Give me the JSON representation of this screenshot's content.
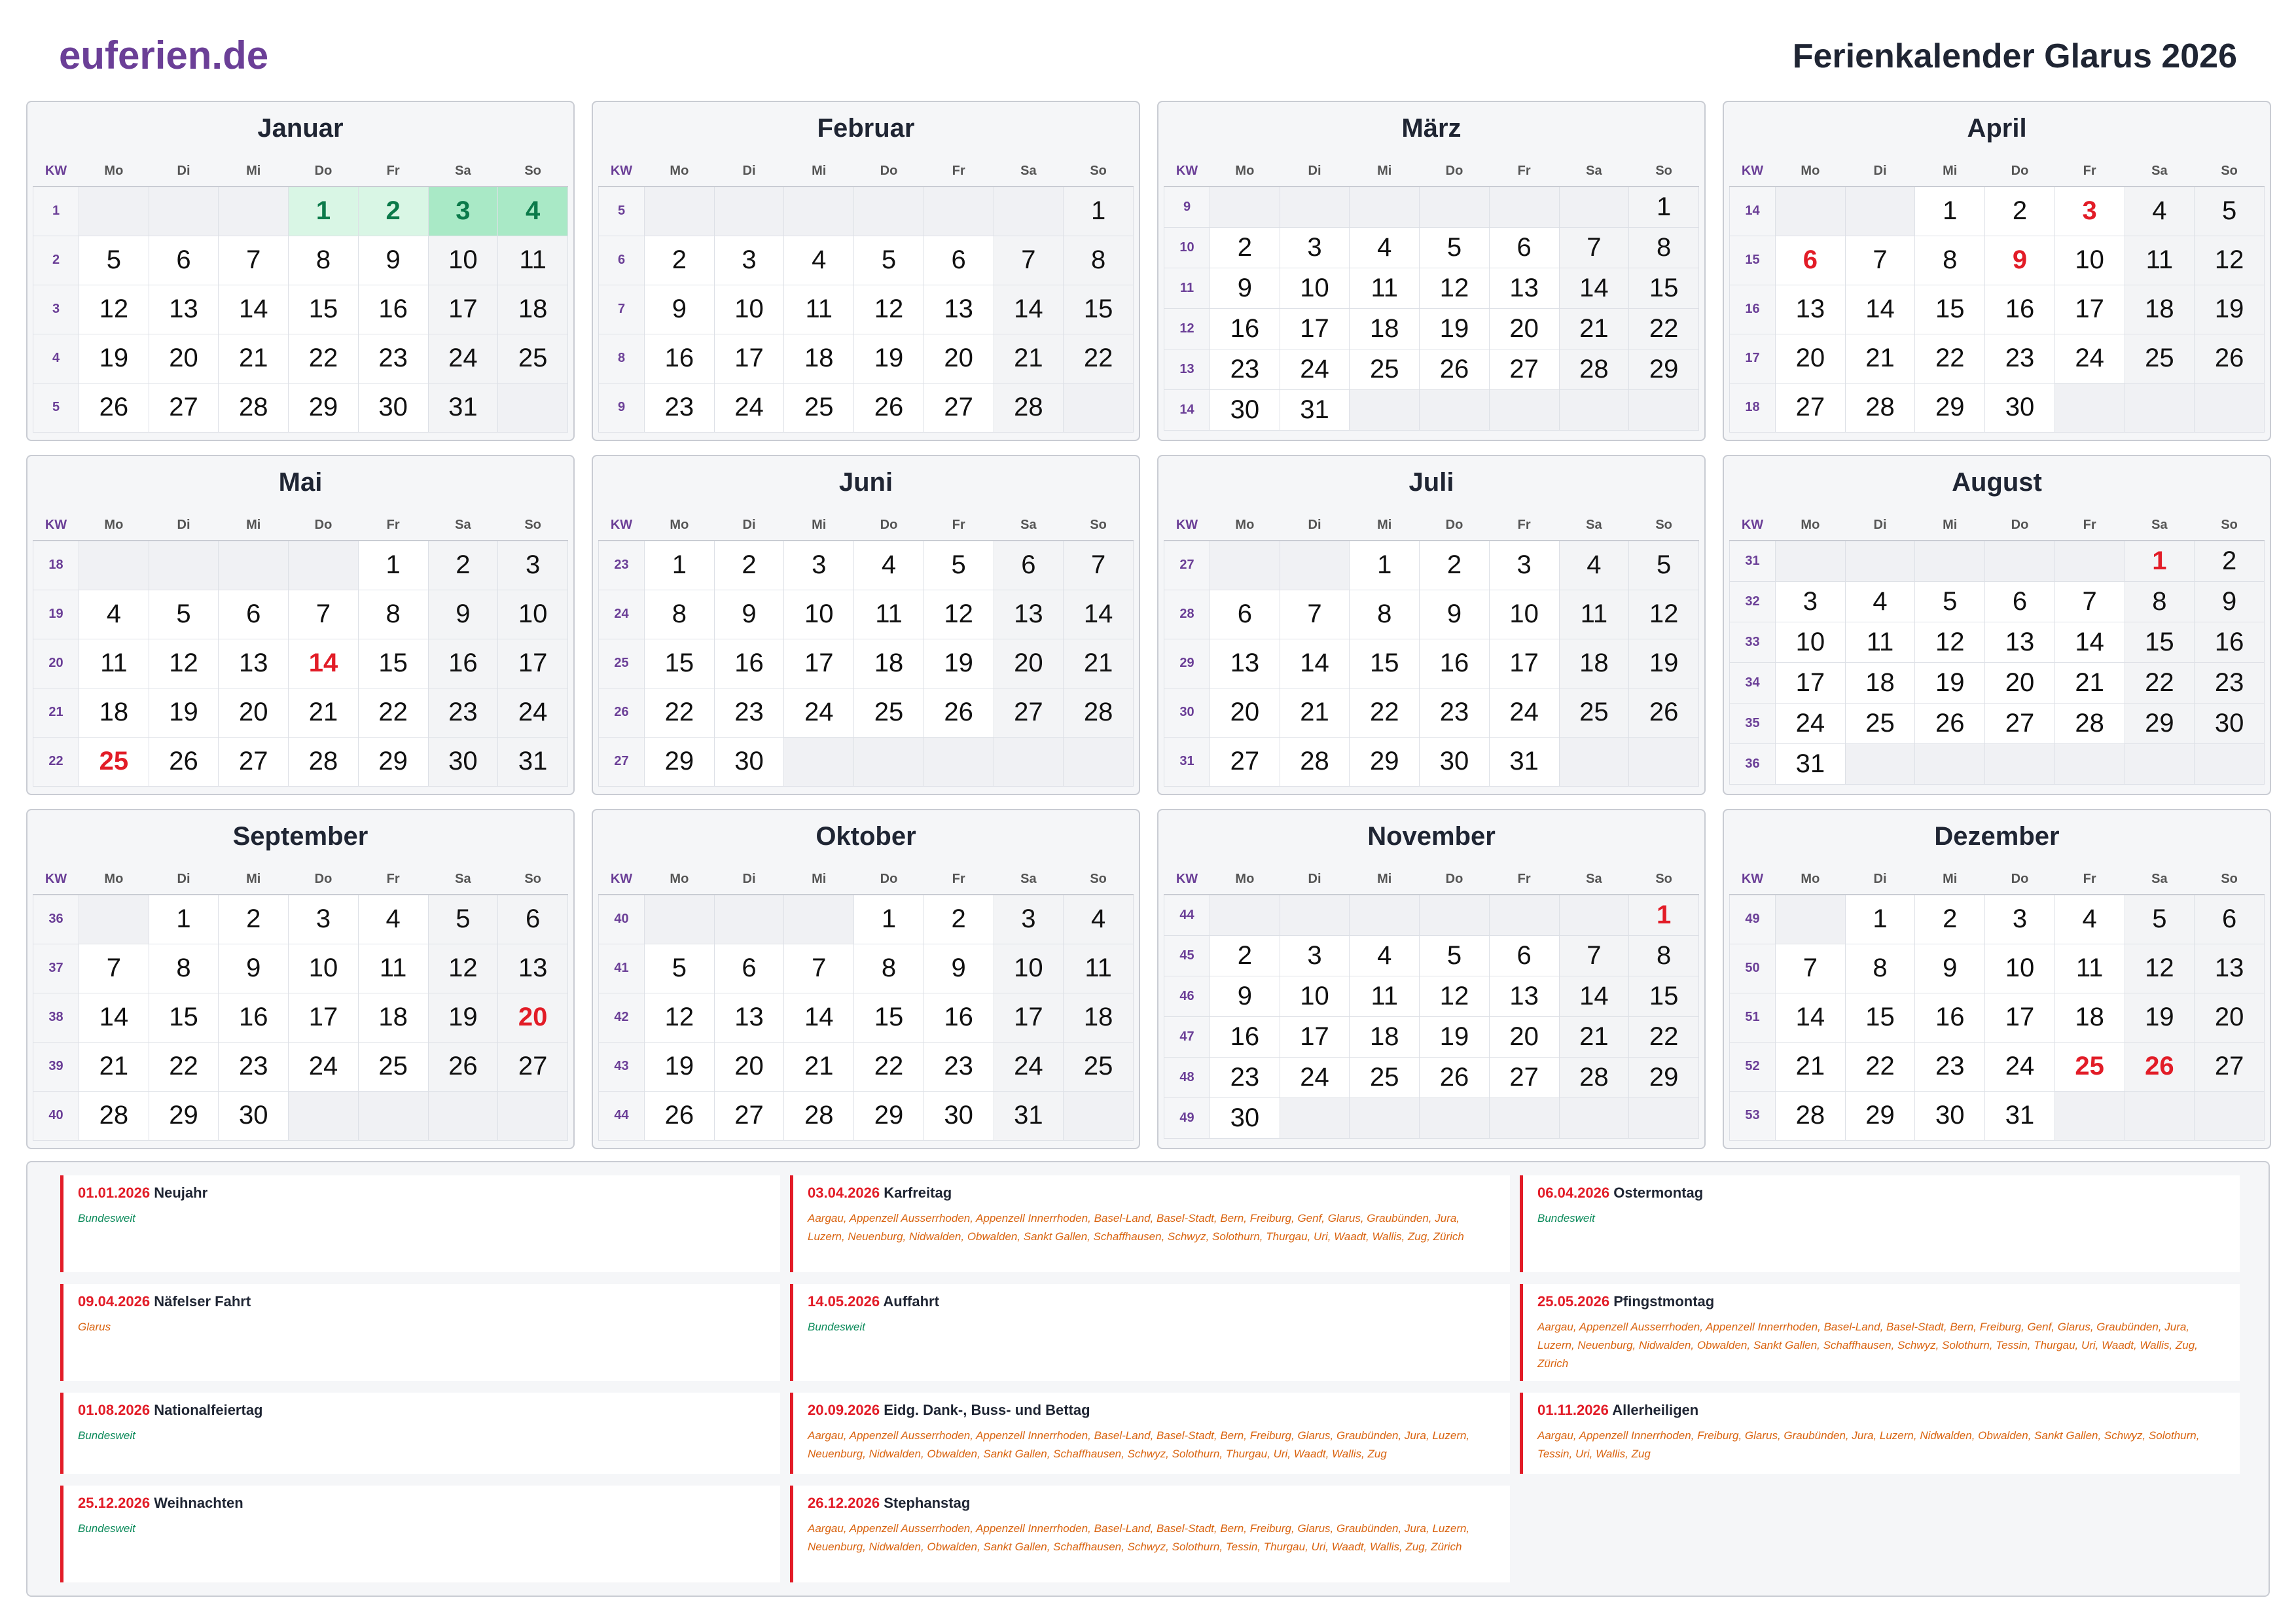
{
  "header": {
    "brand": "euferien.de",
    "title": "Ferienkalender Glarus 2026"
  },
  "weekday_header": [
    "KW",
    "Mo",
    "Di",
    "Mi",
    "Do",
    "Fr",
    "Sa",
    "So"
  ],
  "months": [
    {
      "name": "Januar",
      "weeks": [
        {
          "kw": "1",
          "days": [
            "",
            "",
            "",
            "1",
            "2",
            "3",
            "4"
          ]
        },
        {
          "kw": "2",
          "days": [
            "5",
            "6",
            "7",
            "8",
            "9",
            "10",
            "11"
          ]
        },
        {
          "kw": "3",
          "days": [
            "12",
            "13",
            "14",
            "15",
            "16",
            "17",
            "18"
          ]
        },
        {
          "kw": "4",
          "days": [
            "19",
            "20",
            "21",
            "22",
            "23",
            "24",
            "25"
          ]
        },
        {
          "kw": "5",
          "days": [
            "26",
            "27",
            "28",
            "29",
            "30",
            "31",
            ""
          ]
        }
      ],
      "holidays": [
        "1"
      ],
      "vacation": [
        "1",
        "2",
        "3",
        "4"
      ]
    },
    {
      "name": "Februar",
      "weeks": [
        {
          "kw": "5",
          "days": [
            "",
            "",
            "",
            "",
            "",
            "",
            "1"
          ]
        },
        {
          "kw": "6",
          "days": [
            "2",
            "3",
            "4",
            "5",
            "6",
            "7",
            "8"
          ]
        },
        {
          "kw": "7",
          "days": [
            "9",
            "10",
            "11",
            "12",
            "13",
            "14",
            "15"
          ]
        },
        {
          "kw": "8",
          "days": [
            "16",
            "17",
            "18",
            "19",
            "20",
            "21",
            "22"
          ]
        },
        {
          "kw": "9",
          "days": [
            "23",
            "24",
            "25",
            "26",
            "27",
            "28",
            ""
          ]
        }
      ],
      "holidays": [],
      "vacation": []
    },
    {
      "name": "März",
      "weeks": [
        {
          "kw": "9",
          "days": [
            "",
            "",
            "",
            "",
            "",
            "",
            "1"
          ]
        },
        {
          "kw": "10",
          "days": [
            "2",
            "3",
            "4",
            "5",
            "6",
            "7",
            "8"
          ]
        },
        {
          "kw": "11",
          "days": [
            "9",
            "10",
            "11",
            "12",
            "13",
            "14",
            "15"
          ]
        },
        {
          "kw": "12",
          "days": [
            "16",
            "17",
            "18",
            "19",
            "20",
            "21",
            "22"
          ]
        },
        {
          "kw": "13",
          "days": [
            "23",
            "24",
            "25",
            "26",
            "27",
            "28",
            "29"
          ]
        },
        {
          "kw": "14",
          "days": [
            "30",
            "31",
            "",
            "",
            "",
            "",
            ""
          ]
        }
      ],
      "holidays": [],
      "vacation": []
    },
    {
      "name": "April",
      "weeks": [
        {
          "kw": "14",
          "days": [
            "",
            "",
            "1",
            "2",
            "3",
            "4",
            "5"
          ]
        },
        {
          "kw": "15",
          "days": [
            "6",
            "7",
            "8",
            "9",
            "10",
            "11",
            "12"
          ]
        },
        {
          "kw": "16",
          "days": [
            "13",
            "14",
            "15",
            "16",
            "17",
            "18",
            "19"
          ]
        },
        {
          "kw": "17",
          "days": [
            "20",
            "21",
            "22",
            "23",
            "24",
            "25",
            "26"
          ]
        },
        {
          "kw": "18",
          "days": [
            "27",
            "28",
            "29",
            "30",
            "",
            "",
            ""
          ]
        }
      ],
      "holidays": [
        "3",
        "6",
        "9"
      ],
      "vacation": []
    },
    {
      "name": "Mai",
      "weeks": [
        {
          "kw": "18",
          "days": [
            "",
            "",
            "",
            "",
            "1",
            "2",
            "3"
          ]
        },
        {
          "kw": "19",
          "days": [
            "4",
            "5",
            "6",
            "7",
            "8",
            "9",
            "10"
          ]
        },
        {
          "kw": "20",
          "days": [
            "11",
            "12",
            "13",
            "14",
            "15",
            "16",
            "17"
          ]
        },
        {
          "kw": "21",
          "days": [
            "18",
            "19",
            "20",
            "21",
            "22",
            "23",
            "24"
          ]
        },
        {
          "kw": "22",
          "days": [
            "25",
            "26",
            "27",
            "28",
            "29",
            "30",
            "31"
          ]
        }
      ],
      "holidays": [
        "14",
        "25"
      ],
      "vacation": []
    },
    {
      "name": "Juni",
      "weeks": [
        {
          "kw": "23",
          "days": [
            "1",
            "2",
            "3",
            "4",
            "5",
            "6",
            "7"
          ]
        },
        {
          "kw": "24",
          "days": [
            "8",
            "9",
            "10",
            "11",
            "12",
            "13",
            "14"
          ]
        },
        {
          "kw": "25",
          "days": [
            "15",
            "16",
            "17",
            "18",
            "19",
            "20",
            "21"
          ]
        },
        {
          "kw": "26",
          "days": [
            "22",
            "23",
            "24",
            "25",
            "26",
            "27",
            "28"
          ]
        },
        {
          "kw": "27",
          "days": [
            "29",
            "30",
            "",
            "",
            "",
            "",
            ""
          ]
        }
      ],
      "holidays": [],
      "vacation": []
    },
    {
      "name": "Juli",
      "weeks": [
        {
          "kw": "27",
          "days": [
            "",
            "",
            "1",
            "2",
            "3",
            "4",
            "5"
          ]
        },
        {
          "kw": "28",
          "days": [
            "6",
            "7",
            "8",
            "9",
            "10",
            "11",
            "12"
          ]
        },
        {
          "kw": "29",
          "days": [
            "13",
            "14",
            "15",
            "16",
            "17",
            "18",
            "19"
          ]
        },
        {
          "kw": "30",
          "days": [
            "20",
            "21",
            "22",
            "23",
            "24",
            "25",
            "26"
          ]
        },
        {
          "kw": "31",
          "days": [
            "27",
            "28",
            "29",
            "30",
            "31",
            "",
            ""
          ]
        }
      ],
      "holidays": [],
      "vacation": []
    },
    {
      "name": "August",
      "weeks": [
        {
          "kw": "31",
          "days": [
            "",
            "",
            "",
            "",
            "",
            "1",
            "2"
          ]
        },
        {
          "kw": "32",
          "days": [
            "3",
            "4",
            "5",
            "6",
            "7",
            "8",
            "9"
          ]
        },
        {
          "kw": "33",
          "days": [
            "10",
            "11",
            "12",
            "13",
            "14",
            "15",
            "16"
          ]
        },
        {
          "kw": "34",
          "days": [
            "17",
            "18",
            "19",
            "20",
            "21",
            "22",
            "23"
          ]
        },
        {
          "kw": "35",
          "days": [
            "24",
            "25",
            "26",
            "27",
            "28",
            "29",
            "30"
          ]
        },
        {
          "kw": "36",
          "days": [
            "31",
            "",
            "",
            "",
            "",
            "",
            ""
          ]
        }
      ],
      "holidays": [
        "1"
      ],
      "vacation": []
    },
    {
      "name": "September",
      "weeks": [
        {
          "kw": "36",
          "days": [
            "",
            "1",
            "2",
            "3",
            "4",
            "5",
            "6"
          ]
        },
        {
          "kw": "37",
          "days": [
            "7",
            "8",
            "9",
            "10",
            "11",
            "12",
            "13"
          ]
        },
        {
          "kw": "38",
          "days": [
            "14",
            "15",
            "16",
            "17",
            "18",
            "19",
            "20"
          ]
        },
        {
          "kw": "39",
          "days": [
            "21",
            "22",
            "23",
            "24",
            "25",
            "26",
            "27"
          ]
        },
        {
          "kw": "40",
          "days": [
            "28",
            "29",
            "30",
            "",
            "",
            "",
            ""
          ]
        }
      ],
      "holidays": [
        "20"
      ],
      "vacation": []
    },
    {
      "name": "Oktober",
      "weeks": [
        {
          "kw": "40",
          "days": [
            "",
            "",
            "",
            "1",
            "2",
            "3",
            "4"
          ]
        },
        {
          "kw": "41",
          "days": [
            "5",
            "6",
            "7",
            "8",
            "9",
            "10",
            "11"
          ]
        },
        {
          "kw": "42",
          "days": [
            "12",
            "13",
            "14",
            "15",
            "16",
            "17",
            "18"
          ]
        },
        {
          "kw": "43",
          "days": [
            "19",
            "20",
            "21",
            "22",
            "23",
            "24",
            "25"
          ]
        },
        {
          "kw": "44",
          "days": [
            "26",
            "27",
            "28",
            "29",
            "30",
            "31",
            ""
          ]
        }
      ],
      "holidays": [],
      "vacation": []
    },
    {
      "name": "November",
      "weeks": [
        {
          "kw": "44",
          "days": [
            "",
            "",
            "",
            "",
            "",
            "",
            "1"
          ]
        },
        {
          "kw": "45",
          "days": [
            "2",
            "3",
            "4",
            "5",
            "6",
            "7",
            "8"
          ]
        },
        {
          "kw": "46",
          "days": [
            "9",
            "10",
            "11",
            "12",
            "13",
            "14",
            "15"
          ]
        },
        {
          "kw": "47",
          "days": [
            "16",
            "17",
            "18",
            "19",
            "20",
            "21",
            "22"
          ]
        },
        {
          "kw": "48",
          "days": [
            "23",
            "24",
            "25",
            "26",
            "27",
            "28",
            "29"
          ]
        },
        {
          "kw": "49",
          "days": [
            "30",
            "",
            "",
            "",
            "",
            "",
            ""
          ]
        }
      ],
      "holidays": [
        "1"
      ],
      "vacation": []
    },
    {
      "name": "Dezember",
      "weeks": [
        {
          "kw": "49",
          "days": [
            "",
            "1",
            "2",
            "3",
            "4",
            "5",
            "6"
          ]
        },
        {
          "kw": "50",
          "days": [
            "7",
            "8",
            "9",
            "10",
            "11",
            "12",
            "13"
          ]
        },
        {
          "kw": "51",
          "days": [
            "14",
            "15",
            "16",
            "17",
            "18",
            "19",
            "20"
          ]
        },
        {
          "kw": "52",
          "days": [
            "21",
            "22",
            "23",
            "24",
            "25",
            "26",
            "27"
          ]
        },
        {
          "kw": "53",
          "days": [
            "28",
            "29",
            "30",
            "31",
            "",
            "",
            ""
          ]
        }
      ],
      "holidays": [
        "25",
        "26"
      ],
      "vacation": []
    }
  ],
  "holidays": [
    {
      "date": "01.01.2026",
      "name": "Neujahr",
      "regions": "Bundesweit",
      "nationwide": true
    },
    {
      "date": "03.04.2026",
      "name": "Karfreitag",
      "regions": "Aargau, Appenzell Ausserrhoden, Appenzell Innerrhoden, Basel-Land, Basel-Stadt, Bern, Freiburg, Genf, Glarus, Graubünden, Jura, Luzern, Neuenburg, Nidwalden, Obwalden, Sankt Gallen, Schaffhausen, Schwyz, Solothurn, Thurgau, Uri, Waadt, Wallis, Zug, Zürich",
      "nationwide": false
    },
    {
      "date": "06.04.2026",
      "name": "Ostermontag",
      "regions": "Bundesweit",
      "nationwide": true
    },
    {
      "date": "09.04.2026",
      "name": "Näfelser Fahrt",
      "regions": "Glarus",
      "nationwide": false
    },
    {
      "date": "14.05.2026",
      "name": "Auffahrt",
      "regions": "Bundesweit",
      "nationwide": true
    },
    {
      "date": "25.05.2026",
      "name": "Pfingstmontag",
      "regions": "Aargau, Appenzell Ausserrhoden, Appenzell Innerrhoden, Basel-Land, Basel-Stadt, Bern, Freiburg, Genf, Glarus, Graubünden, Jura, Luzern, Neuenburg, Nidwalden, Obwalden, Sankt Gallen, Schaffhausen, Schwyz, Solothurn, Tessin, Thurgau, Uri, Waadt, Wallis, Zug, Zürich",
      "nationwide": false
    },
    {
      "date": "01.08.2026",
      "name": "Nationalfeiertag",
      "regions": "Bundesweit",
      "nationwide": true
    },
    {
      "date": "20.09.2026",
      "name": "Eidg. Dank-, Buss- und Bettag",
      "regions": "Aargau, Appenzell Ausserrhoden, Appenzell Innerrhoden, Basel-Land, Basel-Stadt, Bern, Freiburg, Glarus, Graubünden, Jura, Luzern, Neuenburg, Nidwalden, Obwalden, Sankt Gallen, Schaffhausen, Schwyz, Solothurn, Thurgau, Uri, Waadt, Wallis, Zug",
      "nationwide": false
    },
    {
      "date": "01.11.2026",
      "name": "Allerheiligen",
      "regions": "Aargau, Appenzell Innerrhoden, Freiburg, Glarus, Graubünden, Jura, Luzern, Nidwalden, Obwalden, Sankt Gallen, Schwyz, Solothurn, Tessin, Uri, Wallis, Zug",
      "nationwide": false
    },
    {
      "date": "25.12.2026",
      "name": "Weihnachten",
      "regions": "Bundesweit",
      "nationwide": true
    },
    {
      "date": "26.12.2026",
      "name": "Stephanstag",
      "regions": "Aargau, Appenzell Ausserrhoden, Appenzell Innerrhoden, Basel-Land, Basel-Stadt, Bern, Freiburg, Glarus, Graubünden, Jura, Luzern, Neuenburg, Nidwalden, Obwalden, Sankt Gallen, Schaffhausen, Schwyz, Solothurn, Tessin, Thurgau, Uri, Waadt, Wallis, Zug, Zürich",
      "nationwide": false
    }
  ]
}
